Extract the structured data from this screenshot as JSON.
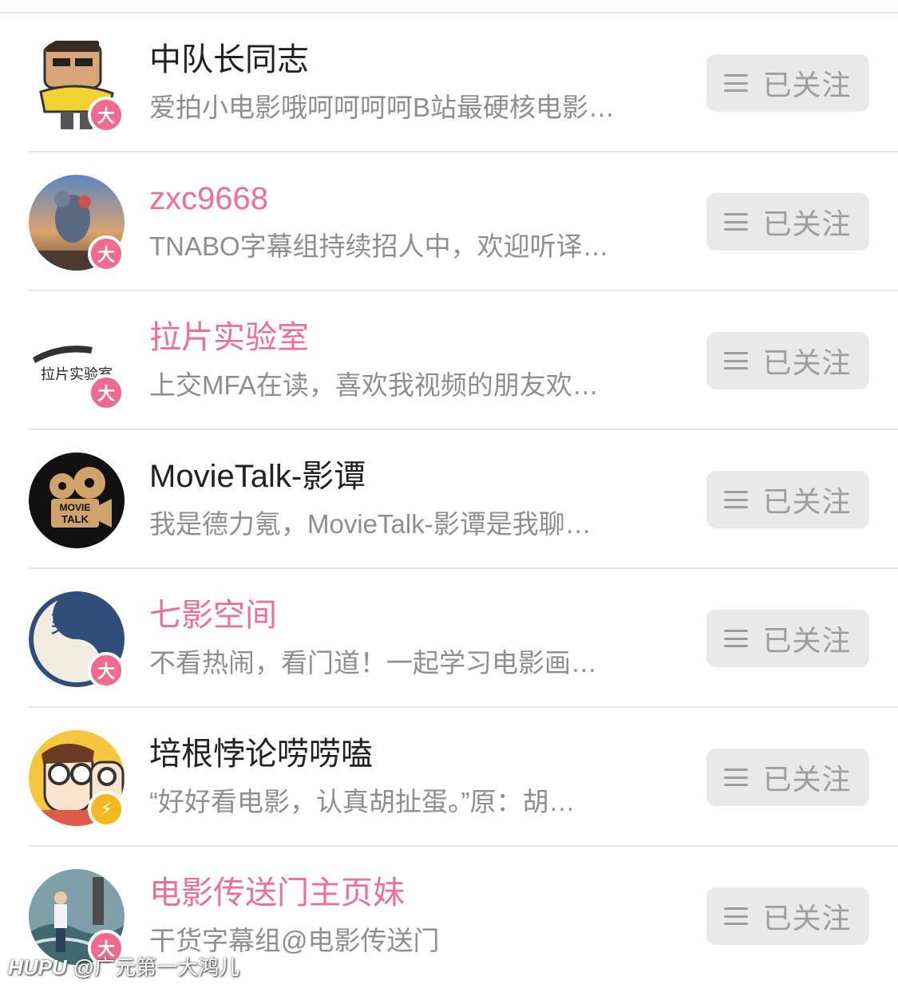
{
  "follow_list": {
    "items": [
      {
        "name": "中队长同志",
        "name_color": "#222222",
        "description": "爱拍小电影哦呵呵呵呵B站最硬核电影…",
        "badge": "大",
        "badge_type": "big-vip",
        "avatar_icon": "cartoon-man-avatar",
        "follow_label": "已关注"
      },
      {
        "name": "zxc9668",
        "name_color": "#ee6f96",
        "description": "TNABO字幕组持续招人中，欢迎听译…",
        "badge": "大",
        "badge_type": "big-vip",
        "avatar_icon": "rat-avatar",
        "follow_label": "已关注"
      },
      {
        "name": "拉片实验室",
        "name_color": "#ee6f96",
        "description": "上交MFA在读，喜欢我视频的朋友欢…",
        "badge": "大",
        "badge_type": "big-vip",
        "avatar_icon": "film-strip-logo-avatar",
        "avatar_text": "拉片实验室",
        "follow_label": "已关注"
      },
      {
        "name": "MovieTalk-影谭",
        "name_color": "#222222",
        "description": "我是德力氪，MovieTalk-影谭是我聊…",
        "badge": "",
        "badge_type": "none",
        "avatar_icon": "film-reel-logo-avatar",
        "avatar_text_1": "MOVIE",
        "avatar_text_2": "TALK",
        "follow_label": "已关注"
      },
      {
        "name": "七影空间",
        "name_color": "#ee6f96",
        "description": "不看热闹，看门道！一起学习电影画…",
        "badge": "大",
        "badge_type": "big-vip",
        "avatar_icon": "calligraphy-avatar",
        "avatar_text_1": "柒",
        "avatar_text_2": "影",
        "follow_label": "已关注"
      },
      {
        "name": "培根悖论唠唠嗑",
        "name_color": "#222222",
        "description": "“好好看电影，认真胡扯蛋。”原：胡…",
        "badge": "⚡",
        "badge_type": "lightning",
        "avatar_icon": "cartoon-glasses-avatar",
        "follow_label": "已关注"
      },
      {
        "name": "电影传送门主页妹",
        "name_color": "#ee6f96",
        "description": "干货字幕组@电影传送门",
        "badge": "大",
        "badge_type": "big-vip",
        "avatar_icon": "photo-person-avatar",
        "follow_label": "已关注"
      }
    ]
  },
  "watermark": {
    "brand": "HUPU",
    "text": "@广元第一大鸿儿"
  },
  "colors": {
    "pink_name": "#ee6f96",
    "badge_pink": "#f06a8f",
    "badge_yellow": "#f5b91f",
    "button_bg": "#e9e9e9",
    "button_text": "#9d9d9d"
  }
}
